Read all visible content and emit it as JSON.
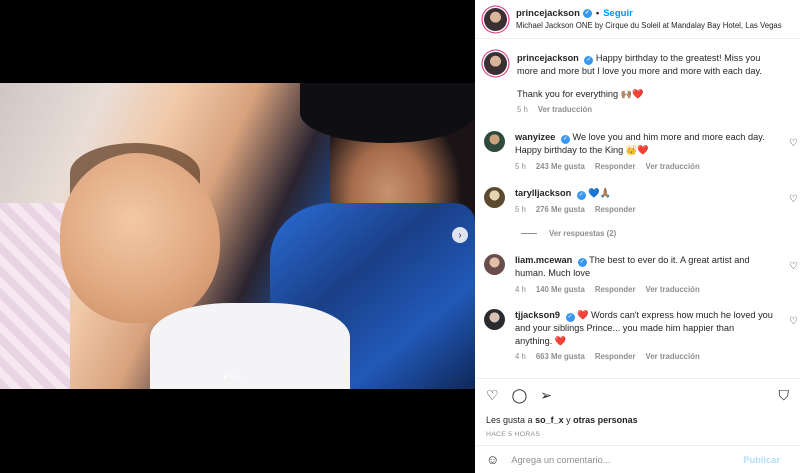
{
  "header": {
    "username": "princejackson",
    "follow_label": "Seguir",
    "location": "Michael Jackson ONE by Cirque du Soleil at Mandalay Bay Hotel, Las Vegas"
  },
  "caption": {
    "username": "princejackson",
    "text": "Happy birthday to the greatest! Miss you more and more but I love you more and more with each day.",
    "text2": "Thank you for everything 🙌🏽❤️",
    "time": "5 h",
    "translate": "Ver traducción"
  },
  "comments": [
    {
      "username": "wanyizee",
      "text": "We love you and him more and more each day. Happy birthday to the King 👑❤️",
      "time": "5 h",
      "likes": "243 Me gusta",
      "reply": "Responder",
      "translate": "Ver traducción"
    },
    {
      "username": "tarylljackson",
      "text": "💙🙏🏽",
      "time": "5 h",
      "likes": "276 Me gusta",
      "reply": "Responder"
    },
    {
      "username": "liam.mcewan",
      "text": "The best to ever do it. A great artist and human. Much love",
      "time": "4 h",
      "likes": "140 Me gusta",
      "reply": "Responder",
      "translate": "Ver traducción"
    },
    {
      "username": "tjjackson9",
      "text": "❤️ Words can't express how much he loved you and your siblings Prince... you made him happier than anything. ❤️",
      "time": "4 h",
      "likes": "663 Me gusta",
      "reply": "Responder",
      "translate": "Ver traducción"
    }
  ],
  "replies_label": "Ver respuestas (2)",
  "likes": {
    "prefix": "Les gusta a",
    "user": "so_f_x",
    "joiner": "y",
    "others": "otras personas"
  },
  "timestamp": "HACE 5 HORAS",
  "add_comment": {
    "placeholder": "Agrega un comentario...",
    "publish": "Publicar"
  },
  "icons": {
    "like": "heart-icon",
    "comment": "comment-icon",
    "share": "share-icon",
    "save": "bookmark-icon",
    "emoji": "emoji-icon",
    "next": "chevron-right-icon"
  },
  "colors": {
    "accent": "#0095f6",
    "verified": "#3897f0",
    "publish_disabled": "#b2dffc"
  }
}
